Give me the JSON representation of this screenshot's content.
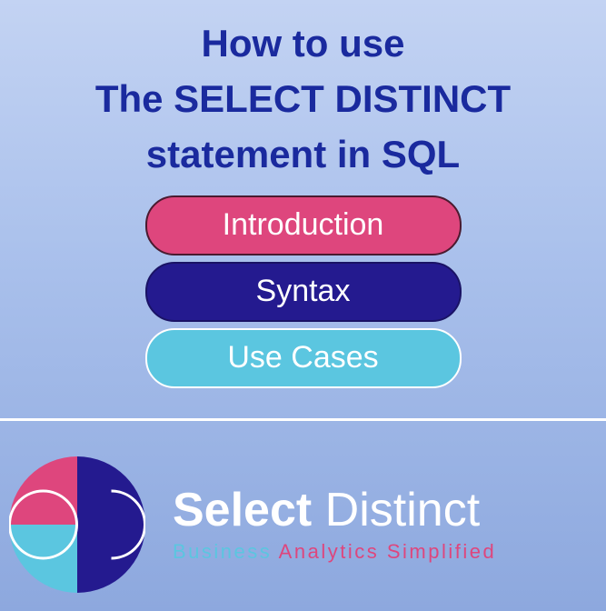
{
  "title": {
    "line1": "How to use",
    "line2": "The SELECT DISTINCT",
    "line3": "statement in SQL"
  },
  "buttons": {
    "introduction": "Introduction",
    "syntax": "Syntax",
    "use_cases": "Use Cases"
  },
  "brand": {
    "name_part1": "Select",
    "name_part2": "Distinct",
    "tagline_part1": "Business ",
    "tagline_part2": "Analytics Simplified"
  },
  "colors": {
    "title": "#1a2a9e",
    "pink": "#de467d",
    "navy": "#241a8f",
    "cyan": "#5bc6e0"
  }
}
